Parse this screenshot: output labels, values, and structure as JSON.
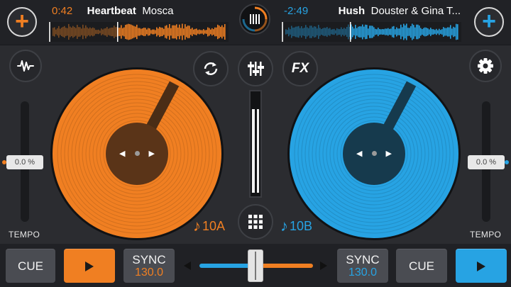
{
  "colors": {
    "left_accent": "#f07f22",
    "right_accent": "#27a3e3",
    "background": "#2b2c30",
    "topbar": "#212226"
  },
  "left_deck": {
    "time": "0:42",
    "title": "Heartbeat",
    "artist": "Mosca",
    "key": "10A",
    "tempo": "0.0 %",
    "tempo_label": "TEMPO",
    "cue_label": "CUE",
    "sync_label": "SYNC",
    "bpm": "130.0",
    "progress": 0.38,
    "add_icon": "plus-icon",
    "play_icon": "play-icon"
  },
  "right_deck": {
    "time": "-2:49",
    "title": "Hush",
    "artist": "Douster & Gina T...",
    "key": "10B",
    "tempo": "0.0 %",
    "tempo_label": "TEMPO",
    "cue_label": "CUE",
    "sync_label": "SYNC",
    "bpm": "130.0",
    "progress": 0.38,
    "add_icon": "plus-icon",
    "play_icon": "play-icon"
  },
  "controls": {
    "fx_label": "FX",
    "wave_icon": "waveform-icon",
    "loop_icon": "sync-loop-icon",
    "mixer_icon": "mixer-sliders-icon",
    "settings_icon": "gear-icon",
    "grid_icon": "grid-icon",
    "logo_icon": "app-logo-icon"
  },
  "crossfader": {
    "position": 0.5
  }
}
